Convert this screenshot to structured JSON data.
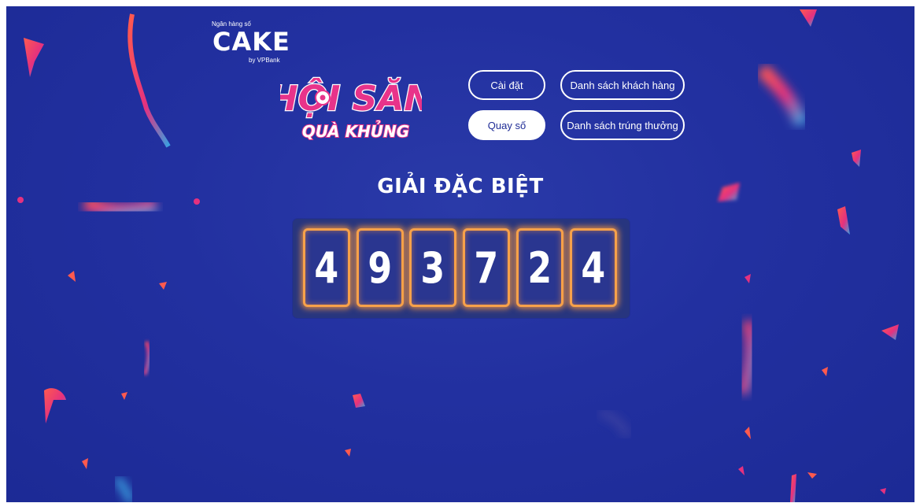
{
  "brand": {
    "caption": "Ngân hàng số",
    "name": "CAKE",
    "sub": "by VPBank"
  },
  "event_logo": {
    "line1": "HỘI SĂN",
    "line2": "QUÀ KHỦNG"
  },
  "nav": {
    "settings_label": "Cài đặt",
    "customers_label": "Danh sách khách hàng",
    "draw_label": "Quay số",
    "winners_label": "Danh sách trúng thưởng"
  },
  "prize": {
    "title": "GIẢI ĐẶC BIỆT",
    "digits": [
      "4",
      "9",
      "3",
      "7",
      "2",
      "4"
    ]
  },
  "colors": {
    "background": "#2230a0",
    "glow": "#f7a14a",
    "logo_pink": "#e8338a"
  }
}
